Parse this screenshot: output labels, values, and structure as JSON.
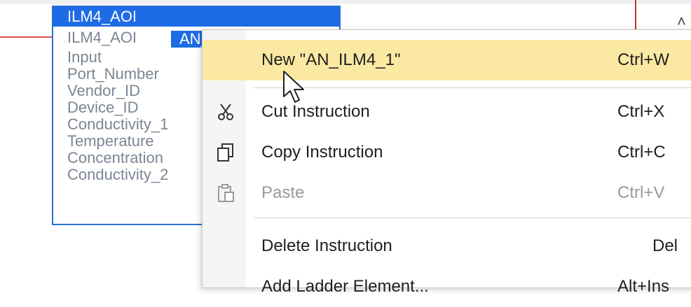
{
  "aoi": {
    "title": "ILM4_AOI",
    "type_name": "ILM4_AOI",
    "tag": "AN_ILM4_1",
    "params": [
      "Input",
      "Port_Number",
      "Vendor_ID",
      "Device_ID",
      "Conductivity_1",
      "Temperature",
      "Concentration",
      "Conductivity_2"
    ]
  },
  "menu": {
    "new_label": "New \"AN_ILM4_1\"",
    "new_shortcut": "Ctrl+W",
    "cut_label": "Cut Instruction",
    "cut_shortcut": "Ctrl+X",
    "copy_label": "Copy Instruction",
    "copy_shortcut": "Ctrl+C",
    "paste_label": "Paste",
    "paste_shortcut": "Ctrl+V",
    "delete_label": "Delete Instruction",
    "delete_shortcut": "Del",
    "add_label": "Add Ladder Element...",
    "add_shortcut": "Alt+Ins"
  },
  "colors": {
    "highlight": "#fbe9a3",
    "aoi_accent": "#1e6be6",
    "rung": "#d9534f"
  }
}
